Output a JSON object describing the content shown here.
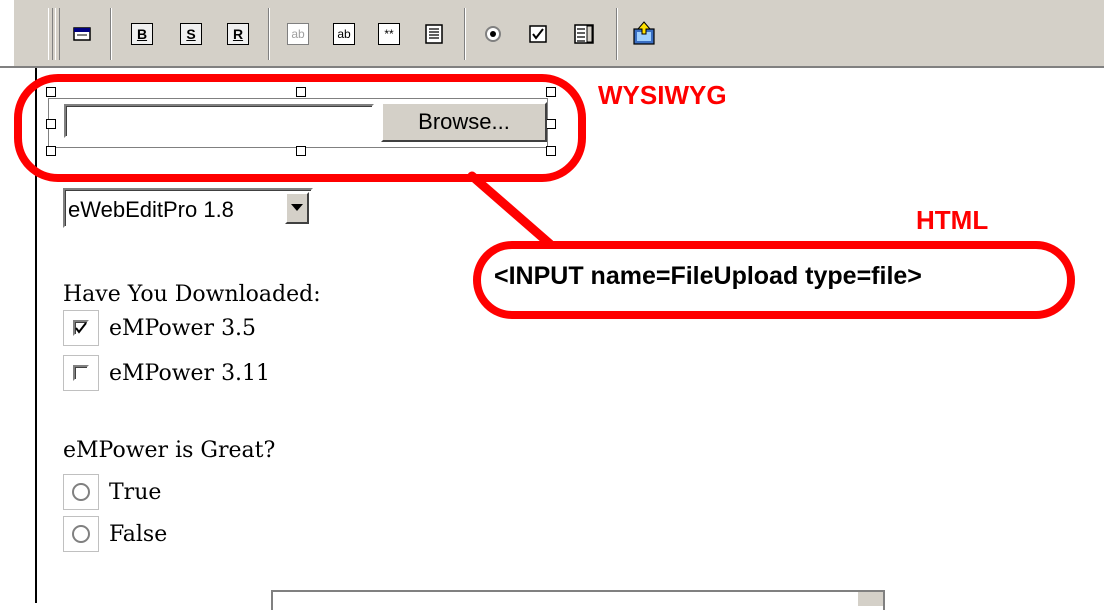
{
  "toolbar": {
    "bold_label": "B",
    "strike_label": "S",
    "reset_label": "R",
    "textfield_gray_label": "ab",
    "textfield_label": "ab",
    "password_label": "**"
  },
  "file_input": {
    "value": "",
    "browse_label": "Browse..."
  },
  "annotations": {
    "wysiwyg_label": "WYSIWYG",
    "html_label": "HTML",
    "html_code": "<INPUT name=FileUpload type=file>",
    "color": "#ff0000"
  },
  "select": {
    "selected": "eWebEditPro 1.8"
  },
  "downloads": {
    "question": "Have You Downloaded:",
    "options": [
      {
        "label": "eMPower 3.5",
        "checked": true
      },
      {
        "label": "eMPower 3.11",
        "checked": false
      }
    ]
  },
  "great": {
    "question": "eMPower is Great?",
    "options": [
      {
        "label": "True"
      },
      {
        "label": "False"
      }
    ]
  }
}
